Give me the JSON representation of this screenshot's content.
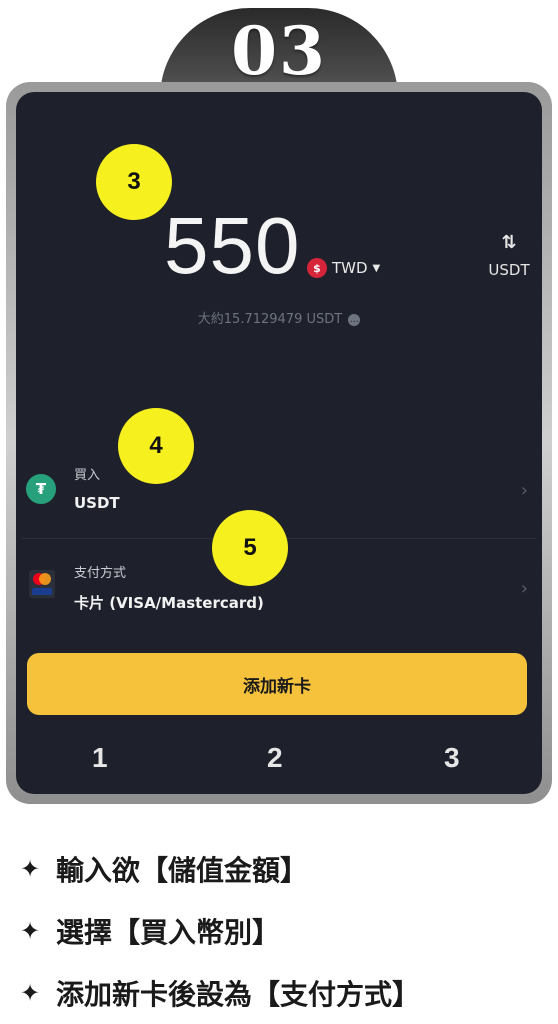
{
  "step_number": "03",
  "amount": "550",
  "currency": {
    "code": "TWD",
    "symbol_icon": "twd-currency-icon"
  },
  "swap": {
    "label": "USDT",
    "icon": "swap-arrows-icon"
  },
  "approx_text": "大約15.7129479 USDT",
  "callouts": [
    "3",
    "4",
    "5"
  ],
  "rows": [
    {
      "sub": "買入",
      "main": "USDT",
      "icon": "tether-icon"
    },
    {
      "sub": "支付方式",
      "main": "卡片 (VISA/Mastercard)",
      "icon": "card-icon"
    }
  ],
  "cta_label": "添加新卡",
  "progress_steps": [
    "1",
    "2",
    "3"
  ],
  "instructions": [
    "輸入欲【儲值金額】",
    "選擇【買入幣別】",
    "添加新卡後設為【支付方式】"
  ],
  "colors": {
    "accent": "#f6c23c",
    "callout": "#f5f01e",
    "screen_bg": "#1e212b"
  }
}
